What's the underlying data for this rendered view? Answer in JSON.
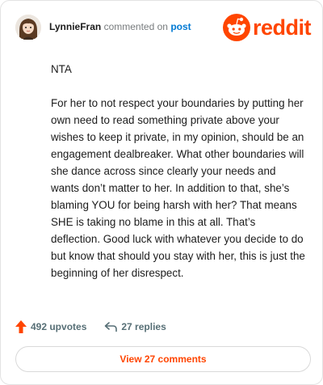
{
  "header": {
    "username": "LynnieFran",
    "commented_on": "commented on",
    "post_link": "post",
    "avatar_icon": "user-avatar-icon",
    "logo_text": "reddit"
  },
  "comment": {
    "paragraphs": [
      "NTA",
      "For her to not respect your boundaries by putting her own need to read something private above your wishes to keep it private, in my opinion, should be an engagement dealbreaker. What other boundaries will she dance across since clearly your needs and wants don’t matter to her. In addition to that, she’s blaming YOU for being harsh with her? That means SHE is taking no blame in this at all. That’s deflection. Good luck with whatever you decide to do but know that should you stay with her, this is just the beginning of her disrespect."
    ]
  },
  "actions": {
    "upvotes_label": "492 upvotes",
    "replies_label": "27 replies",
    "upvote_icon": "upvote-arrow-icon",
    "reply_icon": "reply-arrow-icon"
  },
  "view_comments_label": "View 27 comments",
  "colors": {
    "brand": "#ff4500",
    "link": "#0079d3",
    "muted": "#787c7e",
    "action_text": "#576f76"
  }
}
